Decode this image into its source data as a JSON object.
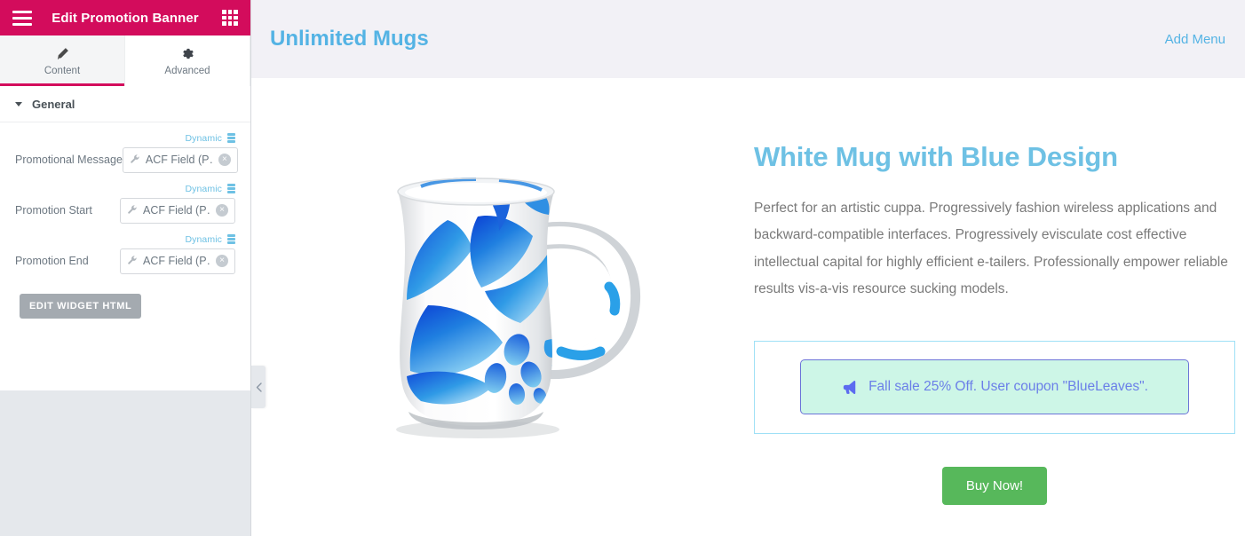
{
  "panel": {
    "header": {
      "title": "Edit Promotion Banner",
      "menu_icon": "hamburger-icon",
      "grid_icon": "grid-apps-icon",
      "bg_color": "#d30c5c"
    },
    "tabs": [
      {
        "label": "Content",
        "icon": "pencil-icon",
        "active": true
      },
      {
        "label": "Advanced",
        "icon": "gear-icon",
        "active": false
      }
    ],
    "section": {
      "title": "General",
      "collapsed": false
    },
    "fields": [
      {
        "label": "Promotional Message",
        "dynamic_label": "Dynamic",
        "value": "ACF Field (P…)",
        "clear_glyph": "×"
      },
      {
        "label": "Promotion Start",
        "dynamic_label": "Dynamic",
        "value": "ACF Field (P…)",
        "clear_glyph": "×"
      },
      {
        "label": "Promotion End",
        "dynamic_label": "Dynamic",
        "value": "ACF Field (P…)",
        "clear_glyph": "×"
      }
    ],
    "edit_html_button": "EDIT WIDGET HTML",
    "collapse_icon": "chevron-left-icon",
    "dynamic_color": "#6ec1e4"
  },
  "preview": {
    "site_header": {
      "logo": "Unlimited Mugs",
      "add_menu": "Add Menu",
      "bg_color": "#f2f1f6",
      "accent_color": "#54b3e4"
    },
    "product": {
      "image_alt": "white-mug-blue-floral-design",
      "title": "White Mug with Blue Design",
      "description": "Perfect for an artistic cuppa. Progressively fashion wireless applications and backward-compatible interfaces. Progressively evisculate cost effective intellectual capital for highly efficient e-tailers. Professionally empower reliable results vis-a-vis resource sucking models.",
      "title_color": "#6ec1e4"
    },
    "promo_banner": {
      "icon": "megaphone-icon",
      "text": "Fall sale 25% Off. User coupon \"BlueLeaves\".",
      "bg_color": "#cdf6e7",
      "border_color": "#6b74d8",
      "text_color": "#6b7fe8",
      "outer_border_color": "#9fe0f6"
    },
    "cta": {
      "label": "Buy Now!",
      "bg_color": "#57b85b"
    }
  }
}
